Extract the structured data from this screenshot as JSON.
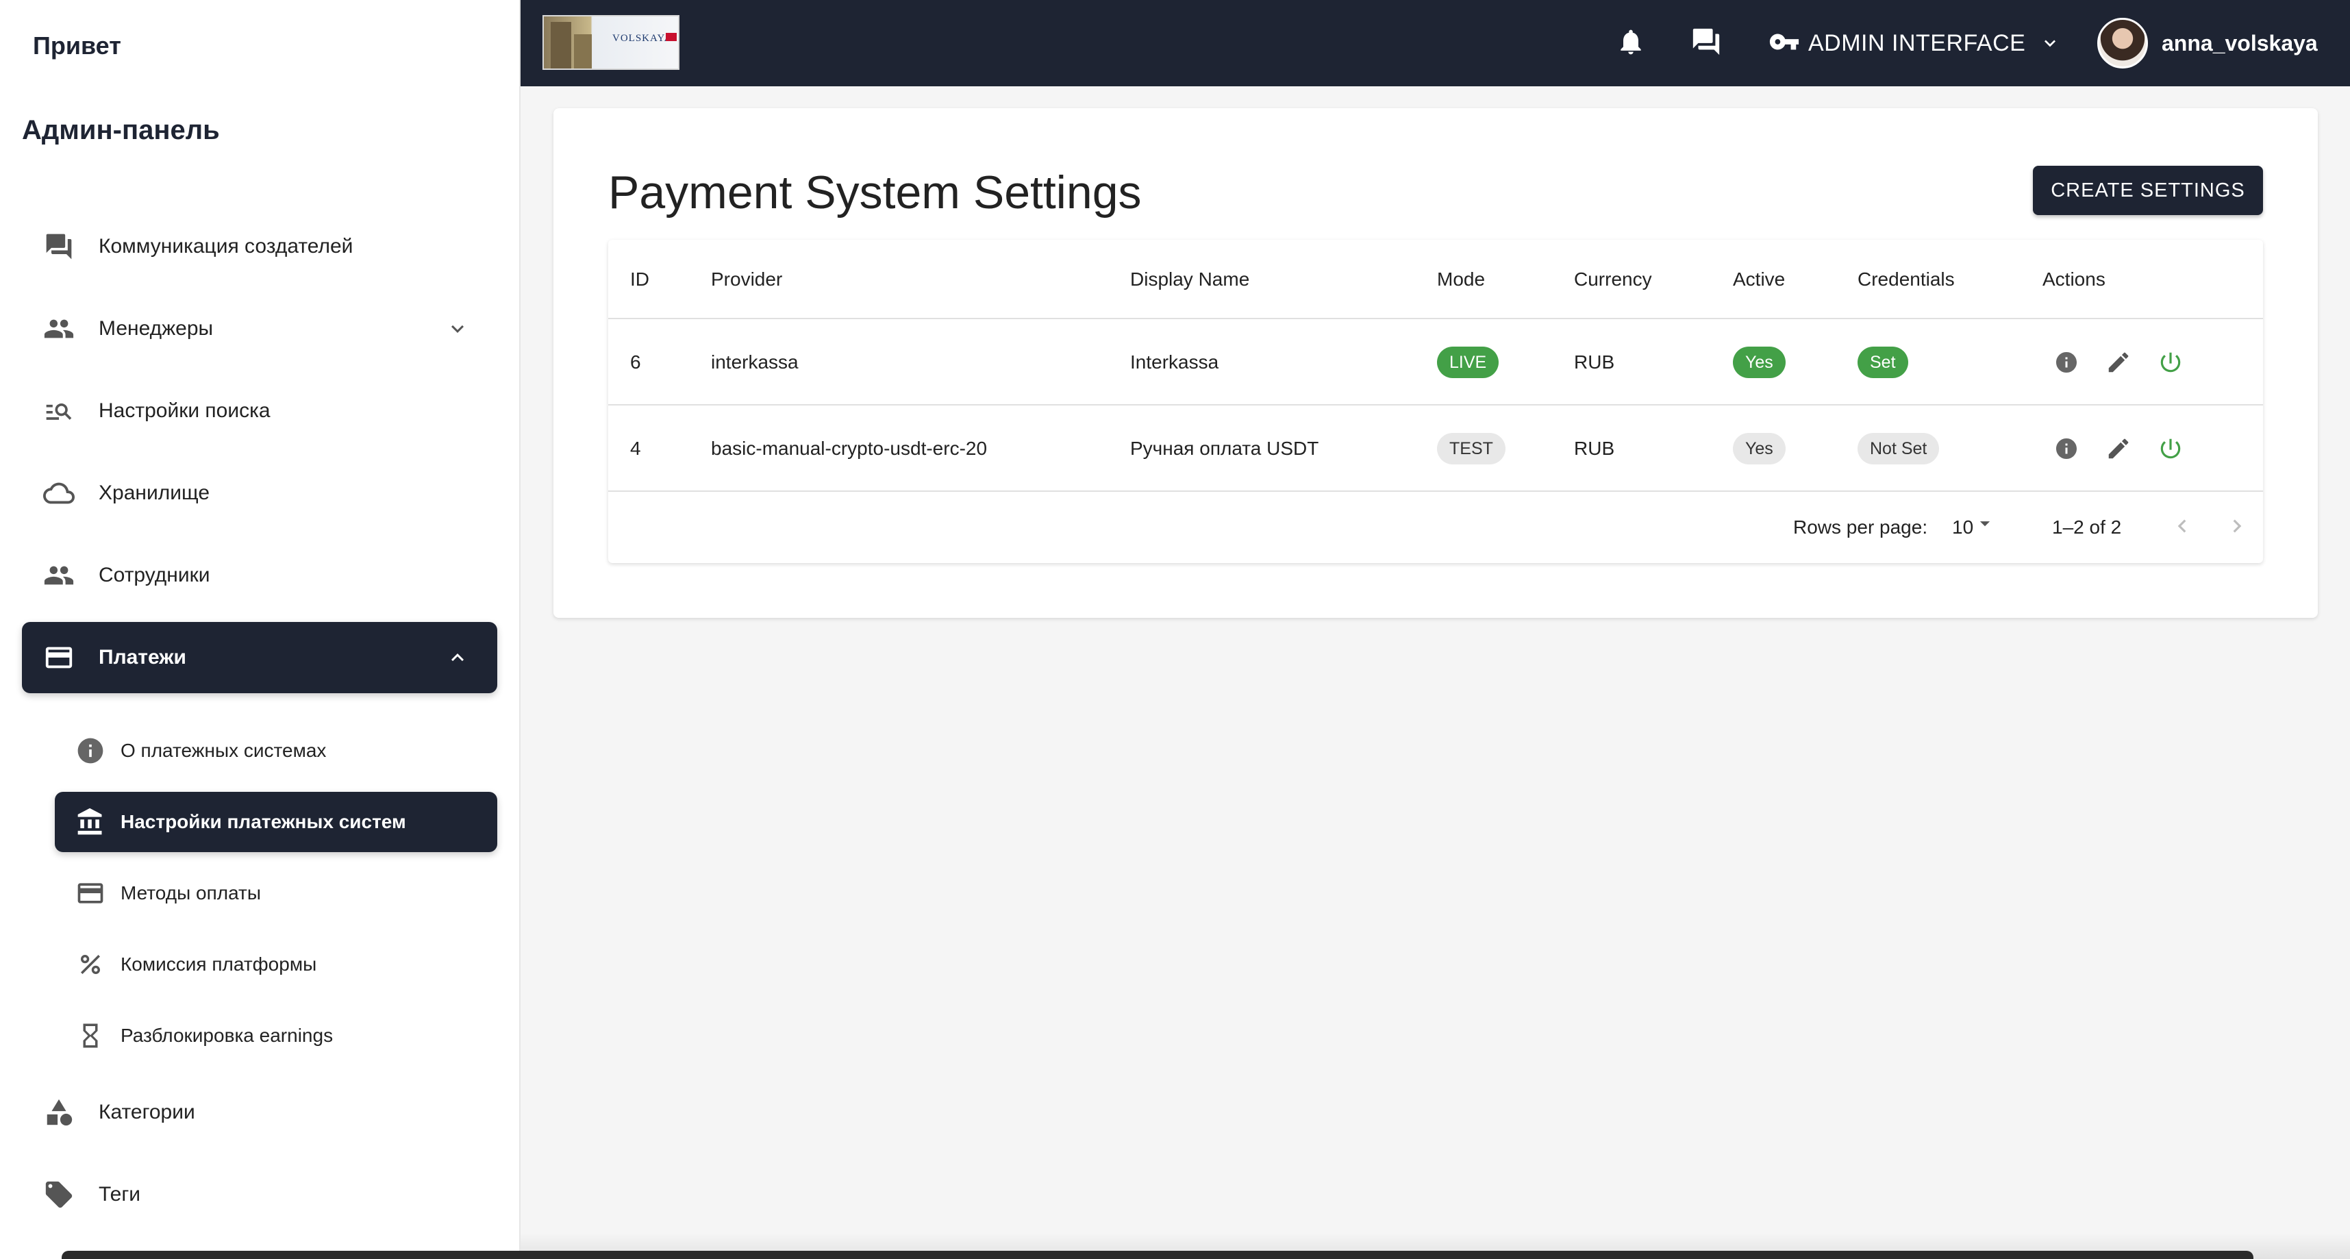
{
  "sidebar": {
    "brand": "Привет",
    "panel_title": "Админ-панель",
    "items": [
      {
        "label": "Коммуникация создателей",
        "icon": "forum-icon"
      },
      {
        "label": "Менеджеры",
        "icon": "people-icon"
      },
      {
        "label": "Настройки поиска",
        "icon": "manage-search-icon"
      },
      {
        "label": "Хранилище",
        "icon": "cloud-icon"
      },
      {
        "label": "Сотрудники",
        "icon": "people-icon"
      },
      {
        "label": "Платежи",
        "icon": "credit-card-icon"
      },
      {
        "label": "Категории",
        "icon": "category-icon"
      },
      {
        "label": "Теги",
        "icon": "tag-icon"
      }
    ],
    "payments_sub": [
      {
        "label": "О платежных системах",
        "icon": "info-icon"
      },
      {
        "label": "Настройки платежных систем",
        "icon": "bank-icon"
      },
      {
        "label": "Методы оплаты",
        "icon": "credit-card-icon"
      },
      {
        "label": "Комиссия платформы",
        "icon": "percent-icon"
      },
      {
        "label": "Разблокировка earnings",
        "icon": "hourglass-icon"
      }
    ]
  },
  "topbar": {
    "logo_text": "VOLSKAYA",
    "admin_label": "ADMIN INTERFACE",
    "username": "anna_volskaya"
  },
  "page": {
    "title": "Payment System Settings",
    "create_label": "CREATE SETTINGS"
  },
  "table": {
    "columns": [
      "ID",
      "Provider",
      "Display Name",
      "Mode",
      "Currency",
      "Active",
      "Credentials",
      "Actions"
    ],
    "rows": [
      {
        "id": "6",
        "provider": "interkassa",
        "display_name": "Interkassa",
        "mode": "LIVE",
        "currency": "RUB",
        "active": "Yes",
        "credentials": "Set"
      },
      {
        "id": "4",
        "provider": "basic-manual-crypto-usdt-erc-20",
        "display_name": "Ручная оплата USDT",
        "mode": "TEST",
        "currency": "RUB",
        "active": "Yes",
        "credentials": "Not Set"
      }
    ]
  },
  "pagination": {
    "rows_per_page_label": "Rows per page:",
    "rows_per_page": "10",
    "range": "1–2 of 2"
  },
  "colors": {
    "primary": "#1e2433",
    "success": "#43a047",
    "chip_grey": "#e8e8e8"
  }
}
